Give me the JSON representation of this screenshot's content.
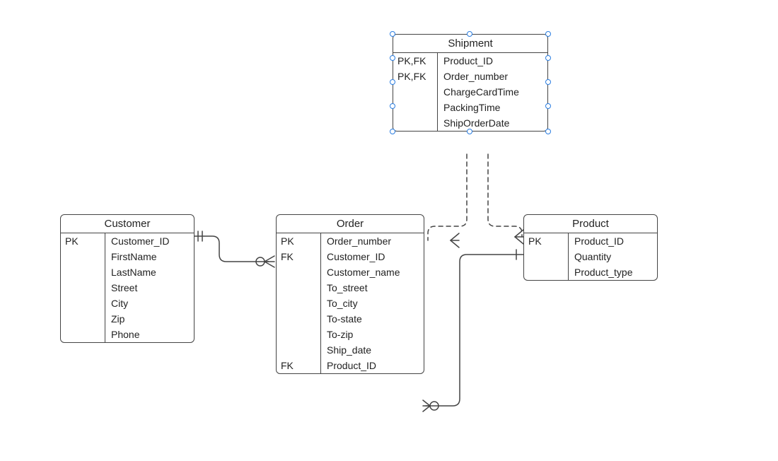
{
  "diagram_type": "entity-relationship",
  "entities": {
    "customer": {
      "title": "Customer",
      "fields": [
        {
          "key": "PK",
          "name": "Customer_ID"
        },
        {
          "key": "",
          "name": "FirstName"
        },
        {
          "key": "",
          "name": "LastName"
        },
        {
          "key": "",
          "name": "Street"
        },
        {
          "key": "",
          "name": "City"
        },
        {
          "key": "",
          "name": "Zip"
        },
        {
          "key": "",
          "name": "Phone"
        }
      ]
    },
    "order": {
      "title": "Order",
      "fields": [
        {
          "key": "PK",
          "name": "Order_number"
        },
        {
          "key": "FK",
          "name": "Customer_ID"
        },
        {
          "key": "",
          "name": "Customer_name"
        },
        {
          "key": "",
          "name": "To_street"
        },
        {
          "key": "",
          "name": "To_city"
        },
        {
          "key": "",
          "name": "To-state"
        },
        {
          "key": "",
          "name": "To-zip"
        },
        {
          "key": "",
          "name": "Ship_date"
        },
        {
          "key": "FK",
          "name": "Product_ID"
        }
      ]
    },
    "shipment": {
      "title": "Shipment",
      "fields": [
        {
          "key": "PK,FK",
          "name": "Product_ID"
        },
        {
          "key": "PK,FK",
          "name": "Order_number"
        },
        {
          "key": "",
          "name": "ChargeCardTime"
        },
        {
          "key": "",
          "name": "PackingTime"
        },
        {
          "key": "",
          "name": "ShipOrderDate"
        }
      ]
    },
    "product": {
      "title": "Product",
      "fields": [
        {
          "key": "PK",
          "name": "Product_ID"
        },
        {
          "key": "",
          "name": "Quantity"
        },
        {
          "key": "",
          "name": "Product_type"
        }
      ]
    }
  },
  "relationships": [
    {
      "from": "Customer",
      "to": "Order",
      "type": "one-to-zero-or-many"
    },
    {
      "from": "Shipment",
      "to": "Order",
      "type": "identifying (dashed)",
      "end": "many"
    },
    {
      "from": "Shipment",
      "to": "Product",
      "type": "identifying (dashed)",
      "end": "many"
    },
    {
      "from": "Order",
      "to": "Product",
      "type": "zero-or-many-to-one"
    }
  ]
}
